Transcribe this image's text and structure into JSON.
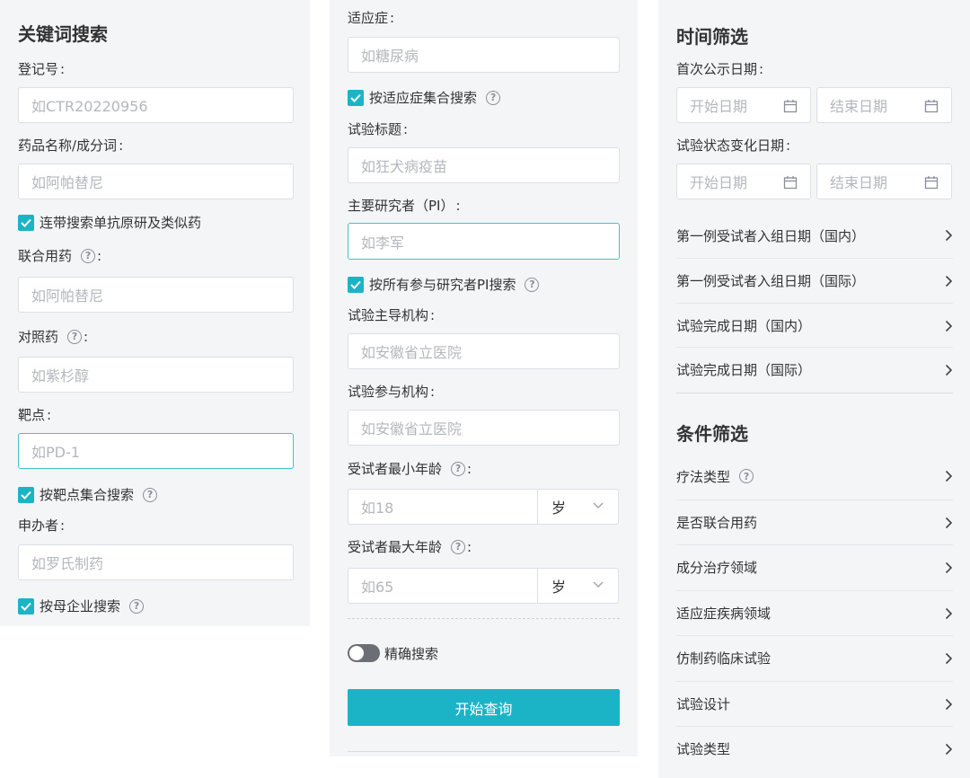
{
  "col1": {
    "title": "关键词搜索",
    "reg_no": {
      "label": "登记号",
      "placeholder": "如CTR20220956"
    },
    "drug_name": {
      "label": "药品名称/成分词",
      "placeholder": "如阿帕替尼"
    },
    "biosimilar_checkbox": "连带搜索单抗原研及类似药",
    "combo_drug": {
      "label": "联合用药",
      "placeholder": "如阿帕替尼"
    },
    "control_drug": {
      "label": "对照药",
      "placeholder": "如紫杉醇"
    },
    "target": {
      "label": "靶点",
      "placeholder": "如PD-1"
    },
    "target_checkbox": "按靶点集合搜索",
    "sponsor": {
      "label": "申办者",
      "placeholder": "如罗氏制药"
    },
    "parent_company_checkbox": "按母企业搜索"
  },
  "col2": {
    "indication": {
      "label": "适应症",
      "placeholder": "如糖尿病"
    },
    "indication_checkbox": "按适应症集合搜索",
    "trial_title": {
      "label": "试验标题",
      "placeholder": "如狂犬病疫苗"
    },
    "pi": {
      "label": "主要研究者（PI）",
      "placeholder": "如李军"
    },
    "pi_checkbox": "按所有参与研究者PI搜索",
    "lead_org": {
      "label": "试验主导机构",
      "placeholder": "如安徽省立医院"
    },
    "participant_org": {
      "label": "试验参与机构",
      "placeholder": "如安徽省立医院"
    },
    "min_age": {
      "label": "受试者最小年龄",
      "placeholder": "如18",
      "unit": "岁"
    },
    "max_age": {
      "label": "受试者最大年龄",
      "placeholder": "如65",
      "unit": "岁"
    },
    "exact_search": {
      "label": "精确搜索",
      "enabled": false
    },
    "search_button": "开始查询"
  },
  "col3": {
    "time_title": "时间筛选",
    "first_public_date": {
      "label": "首次公示日期",
      "start": "开始日期",
      "end": "结束日期"
    },
    "status_change_date": {
      "label": "试验状态变化日期",
      "start": "开始日期",
      "end": "结束日期"
    },
    "time_rows": [
      "第一例受试者入组日期（国内）",
      "第一例受试者入组日期（国际）",
      "试验完成日期（国内）",
      "试验完成日期（国际）"
    ],
    "condition_title": "条件筛选",
    "condition_rows": [
      "疗法类型",
      "是否联合用药",
      "成分治疗领域",
      "适应症疾病领域",
      "仿制药临床试验",
      "试验设计",
      "试验类型"
    ]
  },
  "colors": {
    "accent": "#1bb4c6",
    "focus_border": "#3ec3cf",
    "panel_bg": "#f4f5f7"
  }
}
